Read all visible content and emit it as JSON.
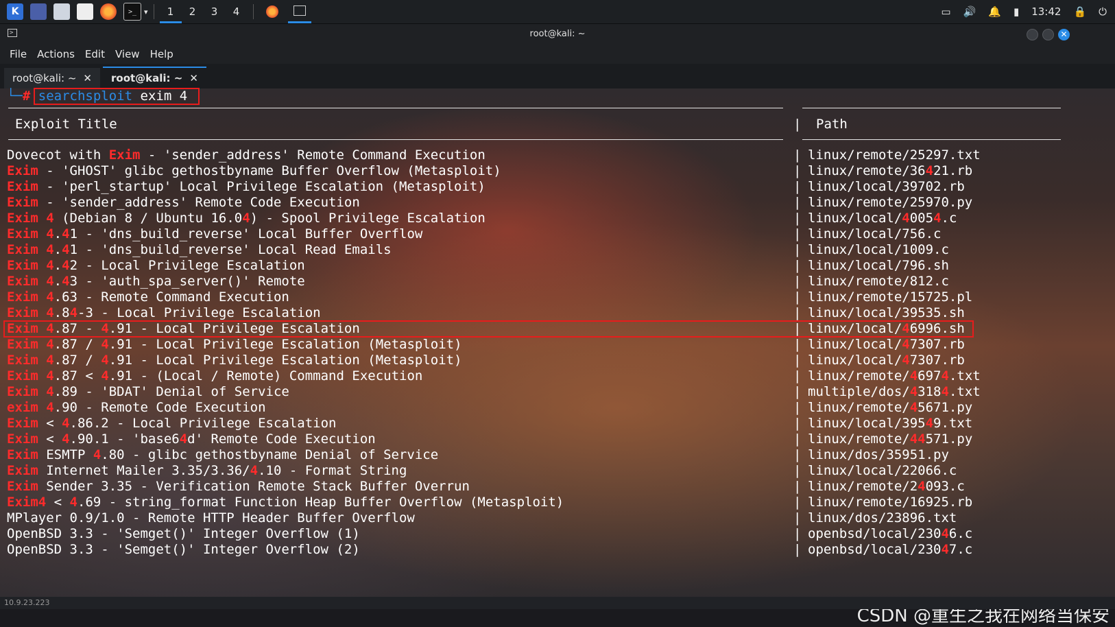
{
  "panel": {
    "workspaces": [
      "1",
      "2",
      "3",
      "4"
    ],
    "active_workspace": "1",
    "clock": "13:42"
  },
  "window": {
    "title": "root@kali: ~",
    "menu": [
      "File",
      "Actions",
      "Edit",
      "View",
      "Help"
    ],
    "tabs": [
      {
        "label": "root@kali: ~",
        "active": false
      },
      {
        "label": "root@kali: ~",
        "active": true
      }
    ]
  },
  "terminal": {
    "command": "searchsploit",
    "command_args": " exim 4",
    "header_title": "Exploit Title",
    "header_path": "Path",
    "rows": [
      {
        "title": "Dovecot with Exim - 'sender_address' Remote Command Execution",
        "path": "linux/remote/25297.txt",
        "selected": false
      },
      {
        "title": "Exim - 'GHOST' glibc gethostbyname Buffer Overflow (Metasploit)",
        "path": "linux/remote/36421.rb",
        "selected": false
      },
      {
        "title": "Exim - 'perl_startup' Local Privilege Escalation (Metasploit)",
        "path": "linux/local/39702.rb",
        "selected": false
      },
      {
        "title": "Exim - 'sender_address' Remote Code Execution",
        "path": "linux/remote/25970.py",
        "selected": false
      },
      {
        "title": "Exim 4 (Debian 8 / Ubuntu 16.04) - Spool Privilege Escalation",
        "path": "linux/local/40054.c",
        "selected": false
      },
      {
        "title": "Exim 4.41 - 'dns_build_reverse' Local Buffer Overflow",
        "path": "linux/local/756.c",
        "selected": false
      },
      {
        "title": "Exim 4.41 - 'dns_build_reverse' Local Read Emails",
        "path": "linux/local/1009.c",
        "selected": false
      },
      {
        "title": "Exim 4.42 - Local Privilege Escalation",
        "path": "linux/local/796.sh",
        "selected": false
      },
      {
        "title": "Exim 4.43 - 'auth_spa_server()' Remote",
        "path": "linux/remote/812.c",
        "selected": false
      },
      {
        "title": "Exim 4.63 - Remote Command Execution",
        "path": "linux/remote/15725.pl",
        "selected": false
      },
      {
        "title": "Exim 4.84-3 - Local Privilege Escalation",
        "path": "linux/local/39535.sh",
        "selected": false
      },
      {
        "title": "Exim 4.87 - 4.91 - Local Privilege Escalation",
        "path": "linux/local/46996.sh",
        "selected": true
      },
      {
        "title": "Exim 4.87 / 4.91 - Local Privilege Escalation (Metasploit)",
        "path": "linux/local/47307.rb",
        "selected": false
      },
      {
        "title": "Exim 4.87 / 4.91 - Local Privilege Escalation (Metasploit)",
        "path": "linux/local/47307.rb",
        "selected": false
      },
      {
        "title": "Exim 4.87 < 4.91 - (Local / Remote) Command Execution",
        "path": "linux/remote/46974.txt",
        "selected": false
      },
      {
        "title": "Exim 4.89 - 'BDAT' Denial of Service",
        "path": "multiple/dos/43184.txt",
        "selected": false
      },
      {
        "title": "exim 4.90 - Remote Code Execution",
        "path": "linux/remote/45671.py",
        "selected": false
      },
      {
        "title": "Exim < 4.86.2 - Local Privilege Escalation",
        "path": "linux/local/39549.txt",
        "selected": false
      },
      {
        "title": "Exim < 4.90.1 - 'base64d' Remote Code Execution",
        "path": "linux/remote/44571.py",
        "selected": false
      },
      {
        "title": "Exim ESMTP 4.80 - glibc gethostbyname Denial of Service",
        "path": "linux/dos/35951.py",
        "selected": false
      },
      {
        "title": "Exim Internet Mailer 3.35/3.36/4.10 - Format String",
        "path": "linux/local/22066.c",
        "selected": false
      },
      {
        "title": "Exim Sender 3.35 - Verification Remote Stack Buffer Overrun",
        "path": "linux/remote/24093.c",
        "selected": false
      },
      {
        "title": "Exim4 < 4.69 - string_format Function Heap Buffer Overflow (Metasploit)",
        "path": "linux/remote/16925.rb",
        "selected": false
      },
      {
        "title": "MPlayer 0.9/1.0 - Remote HTTP Header Buffer Overflow",
        "path": "linux/dos/23896.txt",
        "selected": false
      },
      {
        "title": "OpenBSD 3.3 - 'Semget()' Integer Overflow (1)",
        "path": "openbsd/local/23046.c",
        "selected": false
      },
      {
        "title": "OpenBSD 3.3 - 'Semget()' Integer Overflow (2)",
        "path": "openbsd/local/23047.c",
        "selected": false
      }
    ]
  },
  "statusbar": "10.9.23.223",
  "watermark": "CSDN @重生之我在网络当保安",
  "colors": {
    "accent": "#2b8ce6",
    "highlight": "#ff2b2b",
    "annotation_box": "#e81c1c"
  }
}
